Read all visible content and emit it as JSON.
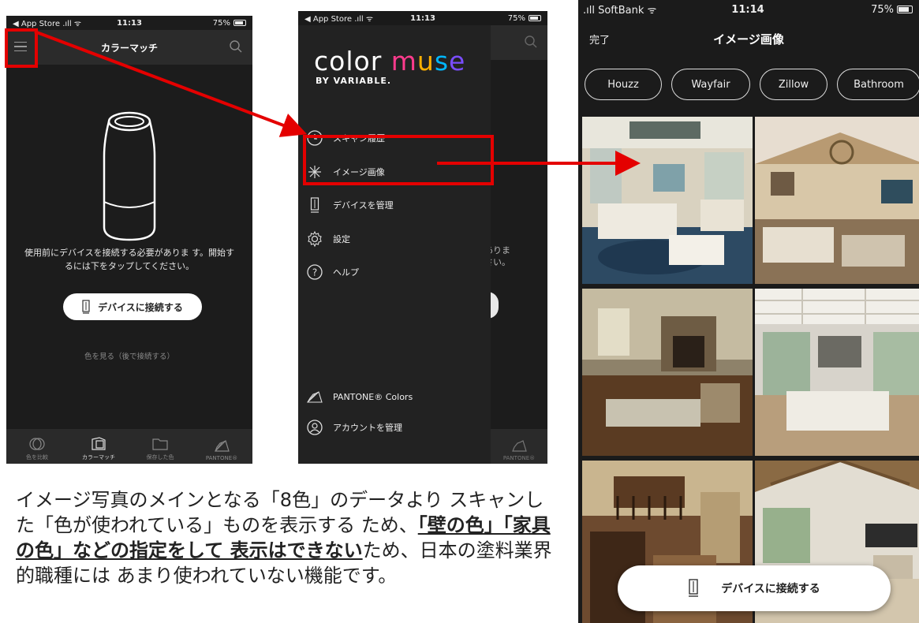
{
  "phone1": {
    "status": {
      "carrier": "◀ App Store .ıll ᯤ",
      "time": "11:13",
      "battery": "75%"
    },
    "title": "カラーマッチ",
    "message": "使用前にデバイスを接続する必要がありま す。開始するには下をタップしてください。",
    "connect_label": "デバイスに接続する",
    "later_label": "色を見る（後で接続する）",
    "tabs": [
      {
        "label": "色を比較",
        "icon": "compare-icon"
      },
      {
        "label": "カラーマッチ",
        "icon": "swatch-book-icon"
      },
      {
        "label": "保存した色",
        "icon": "folder-icon"
      },
      {
        "label": "PANTONE®",
        "icon": "pantone-fan-icon"
      }
    ]
  },
  "phone2": {
    "status": {
      "carrier": "◀ App Store .ıll ᯤ",
      "time": "11:13",
      "battery": "75%"
    },
    "logo": {
      "color": "color",
      "muse": "muse",
      "by": "BY VARIABLE."
    },
    "menu": [
      {
        "label": "スキャン履歴",
        "icon": "history-icon"
      },
      {
        "label": "イメージ画像",
        "icon": "sparkle-icon"
      },
      {
        "label": "デバイスを管理",
        "icon": "device-icon"
      },
      {
        "label": "設定",
        "icon": "gear-icon"
      },
      {
        "label": "ヘルプ",
        "icon": "help-icon"
      }
    ],
    "footer_menu": [
      {
        "label": "PANTONE® Colors",
        "icon": "pantone-fan-icon"
      },
      {
        "label": "アカウントを管理",
        "icon": "account-icon"
      }
    ],
    "behind_text_line1": "ありま",
    "behind_text_line2": "さい。",
    "behind_tab": "PANTONE®"
  },
  "phone3": {
    "status": {
      "carrier": ".ıll SoftBank ᯤ",
      "time": "11:14",
      "battery": "75%"
    },
    "done_label": "完了",
    "title": "イメージ画像",
    "chips": [
      "Houzz",
      "Wayfair",
      "Zillow",
      "Bathroom"
    ],
    "connect_label": "デバイスに接続する"
  },
  "caption": {
    "part1": "イメージ写真のメインとなる「8色」のデータより スキャンした「色が使われている」ものを表示する ため、",
    "emphasis": "「壁の色」「家具の色」などの指定をして 表示はできない",
    "part2": "ため、日本の塗料業界的職種には あまり使われていない機能です。"
  },
  "colors": {
    "highlight": "#e40000",
    "logo_muse_gradient": [
      "#ff3b8d",
      "#ffb000",
      "#00b7ff",
      "#7a4dff"
    ]
  }
}
